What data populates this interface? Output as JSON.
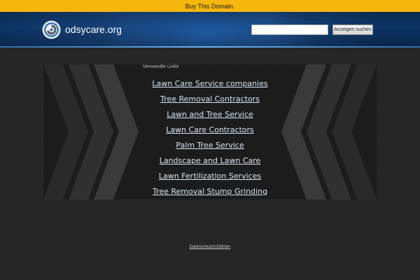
{
  "top_banner": {
    "label": "Buy This Domain."
  },
  "header": {
    "site_name": "odsycare.org",
    "logo_icon": "circular-spiral-logo-icon",
    "search": {
      "value": "",
      "placeholder": "",
      "button_label": "Anzeigen suchen"
    }
  },
  "related": {
    "title": "Verwandte Links",
    "links": [
      {
        "label": "Lawn Care Service companies"
      },
      {
        "label": "Tree Removal Contractors"
      },
      {
        "label": "Lawn and Tree Service"
      },
      {
        "label": "Lawn Care Contractors"
      },
      {
        "label": "Palm Tree Service"
      },
      {
        "label": "Landscape and Lawn Care"
      },
      {
        "label": "Lawn Fertilization Services"
      },
      {
        "label": "Tree Removal Stump Grinding"
      }
    ]
  },
  "footer": {
    "privacy_label": "Datenschutzrichtlinien"
  },
  "colors": {
    "banner": "#f5b70e",
    "header_blue": "#0d3466",
    "link": "#d9e6f3",
    "background": "#262626"
  }
}
